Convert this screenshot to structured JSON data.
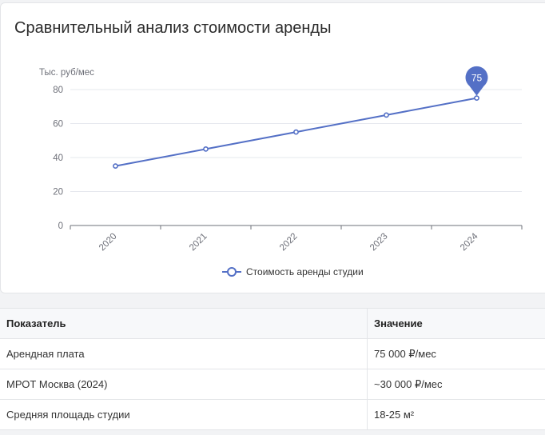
{
  "card": {
    "title": "Сравнительный анализ стоимости аренды"
  },
  "chart_data": {
    "type": "line",
    "categories": [
      "2020",
      "2021",
      "2022",
      "2023",
      "2024"
    ],
    "series": [
      {
        "name": "Стоимость аренды студии",
        "values": [
          35,
          45,
          55,
          65,
          75
        ]
      }
    ],
    "ylabel": "Тыс. руб/мес",
    "ylim": [
      0,
      80
    ],
    "yticks": [
      "0",
      "20",
      "40",
      "60",
      "80"
    ],
    "highlight": {
      "label": "75"
    },
    "legend_position": "bottom",
    "grid": true,
    "colors": {
      "line": "#5470c6",
      "grid": "#e6e8ee",
      "axis": "#6e7079"
    }
  },
  "table": {
    "headers": [
      "Показатель",
      "Значение"
    ],
    "rows": [
      [
        "Арендная плата",
        "75 000 ₽/мес"
      ],
      [
        "МРОТ Москва (2024)",
        "~30 000 ₽/мес"
      ],
      [
        "Средняя площадь студии",
        "18-25 м²"
      ]
    ]
  }
}
